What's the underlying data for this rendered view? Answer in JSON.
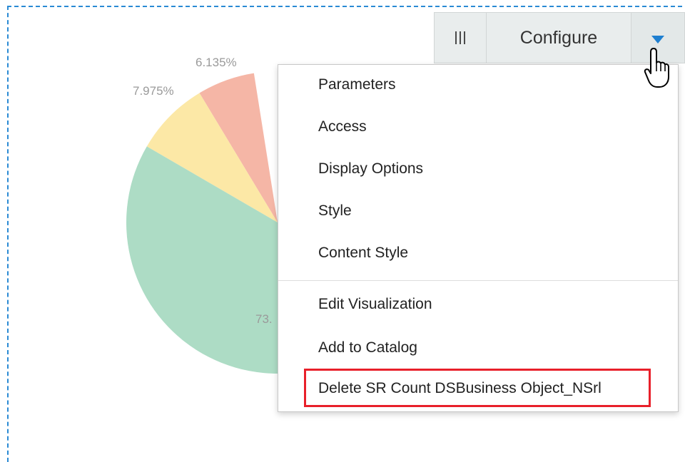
{
  "toolbar": {
    "grip_icon": "column-grip-icon",
    "configure_label": "Configure",
    "dropdown_icon": "caret-down-icon",
    "accent_color": "#1f7fd0"
  },
  "pie": {
    "label_1": "6.135%",
    "label_2": "7.975%",
    "label_3": "73."
  },
  "chart_data": {
    "type": "pie",
    "slices": [
      {
        "label": "6.135%",
        "value": 6.135,
        "color": "#f5b6a6"
      },
      {
        "label": "7.975%",
        "value": 7.975,
        "color": "#fce8a6"
      },
      {
        "label": "73.",
        "value": 73,
        "color": "#addcc5"
      }
    ]
  },
  "menu": {
    "items": [
      {
        "label": "Parameters"
      },
      {
        "label": "Access"
      },
      {
        "label": "Display Options"
      },
      {
        "label": "Style"
      },
      {
        "label": "Content Style"
      },
      {
        "label": "Edit Visualization"
      },
      {
        "label": "Add to Catalog"
      },
      {
        "label": "Delete SR Count DSBusiness Object_NSrl"
      }
    ],
    "highlight_color": "#e8202a"
  }
}
